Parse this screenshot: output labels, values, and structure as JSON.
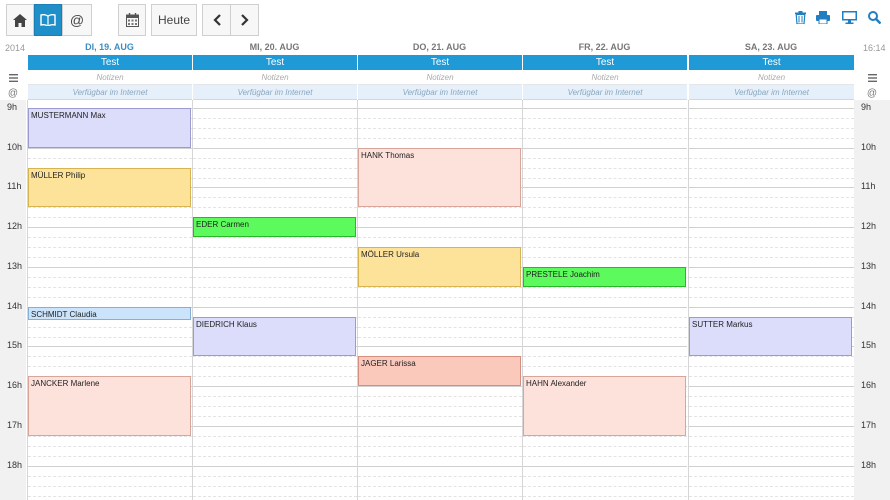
{
  "toolbar": {
    "home_icon": "home-icon",
    "book_icon": "book-icon",
    "at_label": "@",
    "calendar_icon": "calendar-icon",
    "today_label": "Heute",
    "prev_icon": "chevron-left-icon",
    "next_icon": "chevron-right-icon",
    "right_icons": [
      "trash-icon",
      "printer-icon",
      "monitor-icon",
      "search-icon"
    ]
  },
  "header": {
    "year": "2014",
    "clock": "16:14"
  },
  "days": [
    {
      "label": "DI, 19. AUG",
      "today": true
    },
    {
      "label": "MI, 20. AUG",
      "today": false
    },
    {
      "label": "DO, 21. AUG",
      "today": false
    },
    {
      "label": "FR, 22. AUG",
      "today": false
    },
    {
      "label": "SA, 23. AUG",
      "today": false
    }
  ],
  "dept_label": "Test",
  "notes_label": "Notizen",
  "avail_label": "Verfügbar im Internet",
  "side": {
    "menu_icon": "menu-icon",
    "at_label": "@"
  },
  "hours": [
    "9h",
    "10h",
    "11h",
    "12h",
    "13h",
    "14h",
    "15h",
    "16h",
    "17h",
    "18h"
  ],
  "appointments": [
    {
      "day": 0,
      "start": 9.0,
      "end": 10.0,
      "name": "MUSTERMANN Max",
      "color": "purple"
    },
    {
      "day": 0,
      "start": 10.5,
      "end": 11.5,
      "name": "MÜLLER Philip",
      "color": "yellow"
    },
    {
      "day": 0,
      "start": 14.0,
      "end": 14.333,
      "name": "SCHMIDT Claudia",
      "color": "blue"
    },
    {
      "day": 0,
      "start": 15.75,
      "end": 17.25,
      "name": "JANCKER Marlene",
      "color": "pink"
    },
    {
      "day": 1,
      "start": 11.75,
      "end": 12.25,
      "name": "EDER Carmen",
      "color": "green"
    },
    {
      "day": 1,
      "start": 14.25,
      "end": 15.25,
      "name": "DIEDRICH Klaus",
      "color": "purple"
    },
    {
      "day": 2,
      "start": 10.0,
      "end": 11.5,
      "name": "HANK Thomas",
      "color": "pink"
    },
    {
      "day": 2,
      "start": 12.5,
      "end": 13.5,
      "name": "MÖLLER Ursula",
      "color": "yellow"
    },
    {
      "day": 2,
      "start": 15.25,
      "end": 16.0,
      "name": "JAGER Larissa",
      "color": "salmon"
    },
    {
      "day": 3,
      "start": 13.0,
      "end": 13.5,
      "name": "PRESTELE Joachim",
      "color": "green"
    },
    {
      "day": 3,
      "start": 15.75,
      "end": 17.25,
      "name": "HAHN Alexander",
      "color": "pink"
    },
    {
      "day": 4,
      "start": 14.25,
      "end": 15.25,
      "name": "SUTTER Markus",
      "color": "purple"
    }
  ]
}
